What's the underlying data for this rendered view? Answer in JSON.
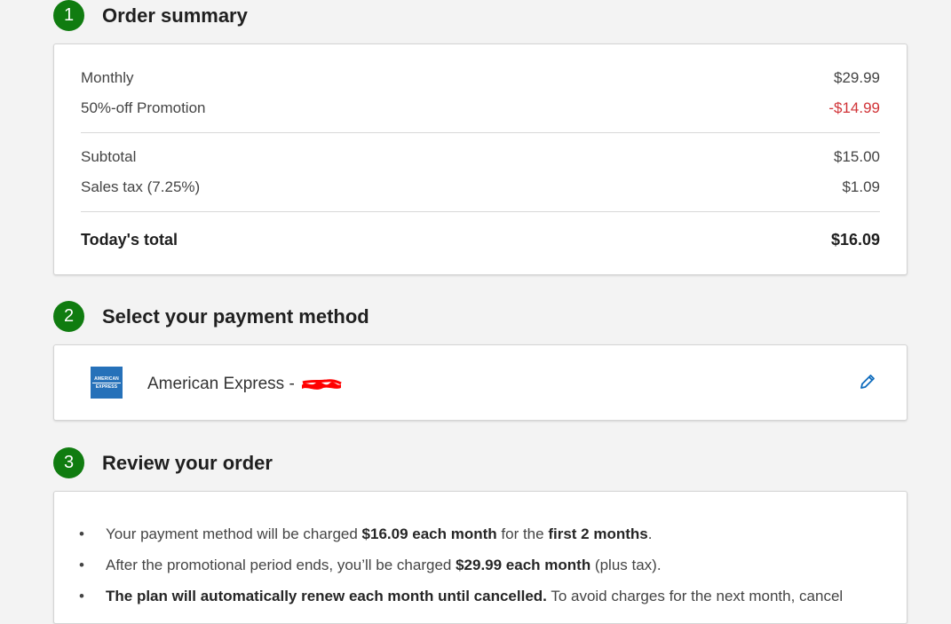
{
  "colors": {
    "step_badge": "#107c10",
    "negative": "#d13438",
    "amex_blue": "#2671b9",
    "edit_icon": "#0f6cbd"
  },
  "step1": {
    "number": "1",
    "title": "Order summary",
    "rows": [
      {
        "label": "Monthly",
        "value": "$29.99"
      },
      {
        "label": "50%-off Promotion",
        "value": "-$14.99"
      },
      {
        "label": "Subtotal",
        "value": "$15.00"
      },
      {
        "label": "Sales tax (7.25%)",
        "value": "$1.09"
      }
    ],
    "total": {
      "label": "Today's total",
      "value": "$16.09"
    }
  },
  "step2": {
    "number": "2",
    "title": "Select your payment method",
    "card_logo_line1": "AMERICAN",
    "card_logo_line2": "EXPRESS",
    "card_label": "American Express - ",
    "edit_icon": "pencil-icon"
  },
  "step3": {
    "number": "3",
    "title": "Review your order",
    "bullets": [
      {
        "p1": "Your payment method will be charged ",
        "b1": "$16.09 each month",
        "p2": " for the ",
        "b2": "first 2 months",
        "p3": "."
      },
      {
        "p1": "After the promotional period ends, you’ll be charged ",
        "b1": "$29.99 each month",
        "p2": " (plus tax).",
        "b2": "",
        "p3": ""
      },
      {
        "p1": "",
        "b1": "The plan will automatically renew each month until cancelled.",
        "p2": " To avoid charges for the next month, cancel",
        "b2": "",
        "p3": ""
      }
    ]
  }
}
